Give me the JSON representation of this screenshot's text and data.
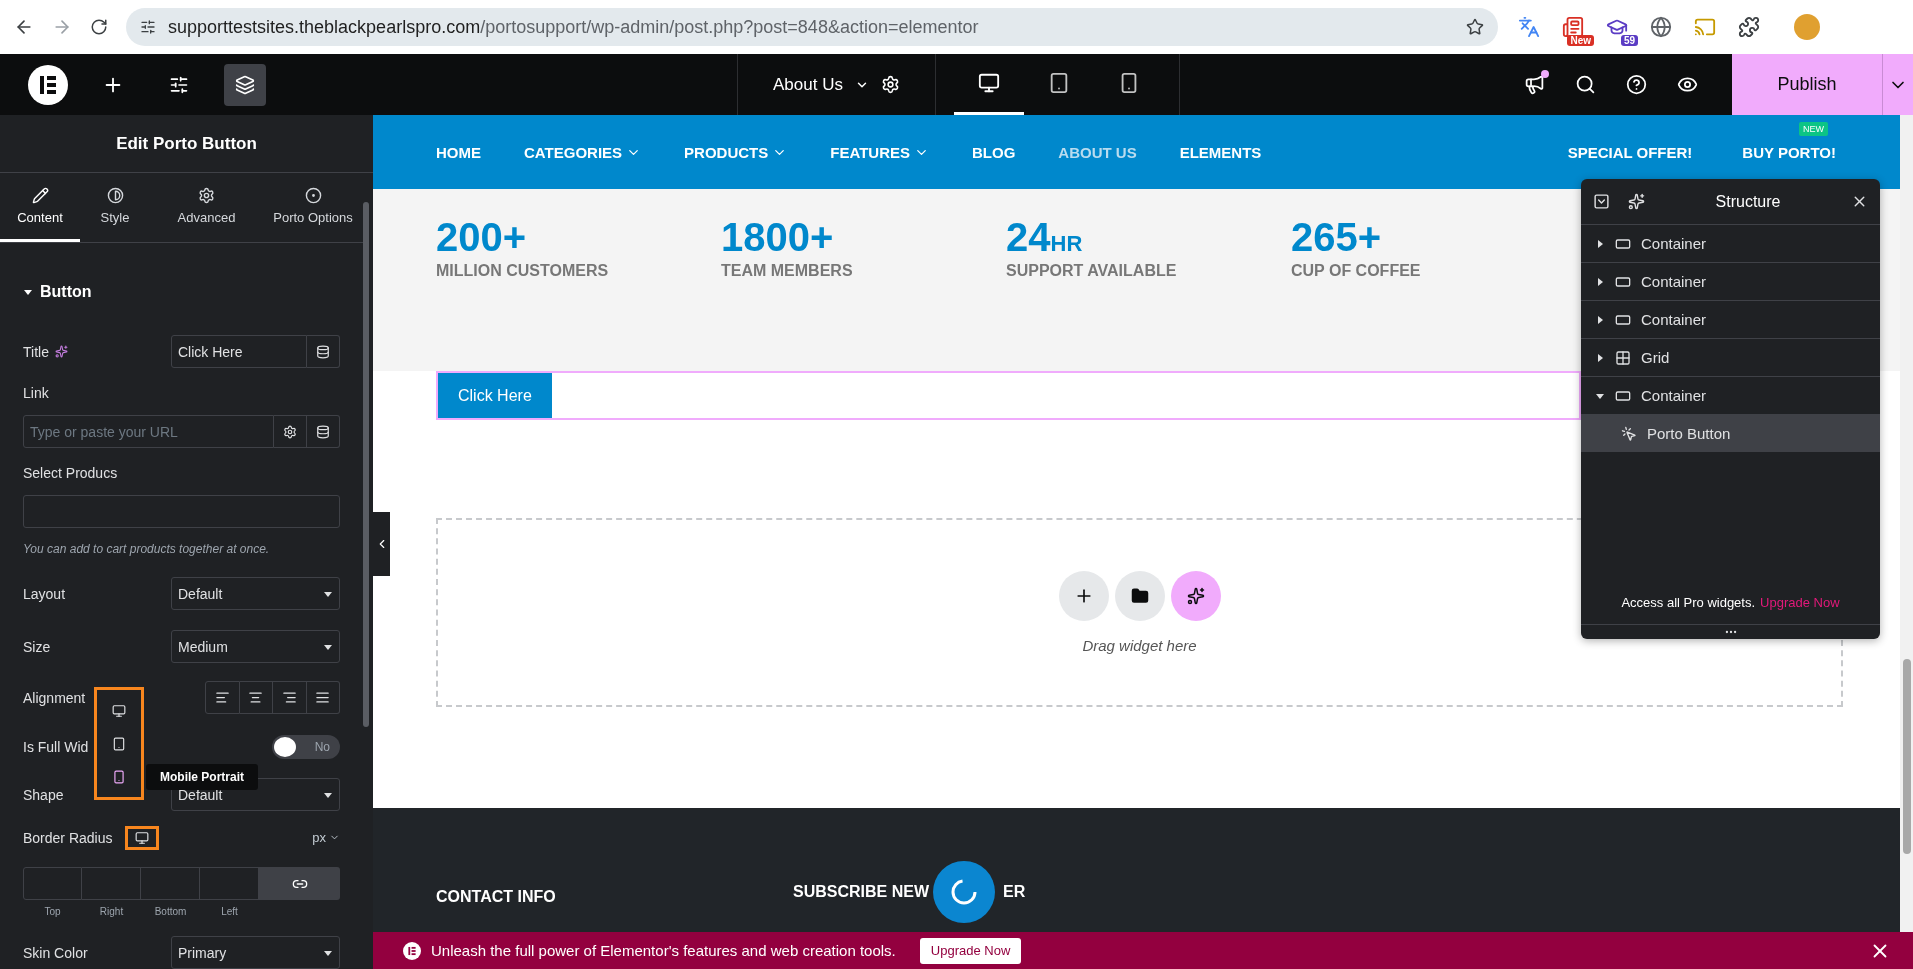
{
  "browser": {
    "url_host": "supporttestsites.theblackpearlspro.com",
    "url_path": "/portosupport/wp-admin/post.php?post=848&action=elementor",
    "extensions": [
      {
        "kind": "translate"
      },
      {
        "kind": "new",
        "badge": "New"
      },
      {
        "kind": "cap",
        "badge": "59"
      },
      {
        "kind": "globe"
      },
      {
        "kind": "cast"
      },
      {
        "kind": "puzzle"
      }
    ]
  },
  "editor_bar": {
    "page_title": "About Us",
    "devices": [
      {
        "kind": "desktop",
        "selected": true
      },
      {
        "kind": "tablet",
        "selected": false
      },
      {
        "kind": "mobile",
        "selected": false
      }
    ],
    "publish": "Publish"
  },
  "panel": {
    "title": "Edit Porto Button",
    "tabs": [
      {
        "label": "Content",
        "kind": "pencil",
        "selected": true
      },
      {
        "label": "Style",
        "kind": "contrast",
        "selected": false
      },
      {
        "label": "Advanced",
        "kind": "gear",
        "selected": false
      },
      {
        "label": "Porto Options",
        "kind": "dot",
        "selected": false
      }
    ],
    "section": {
      "title": "Button",
      "expanded": true
    },
    "controls": [
      {
        "kind": "text",
        "label": "Title",
        "value": "Click Here"
      },
      {
        "kind": "url",
        "label": "Link",
        "placeholder": "Type or paste your URL"
      },
      {
        "kind": "multi",
        "label": "Select Producs"
      },
      {
        "kind": "note",
        "text": "You can add to cart products together at once."
      },
      {
        "kind": "select",
        "label": "Layout",
        "value": "Default"
      },
      {
        "kind": "select",
        "label": "Size",
        "value": "Medium"
      },
      {
        "kind": "align",
        "label": "Alignment"
      },
      {
        "kind": "switch",
        "label": "Is Full Wid",
        "on": false,
        "state_label": "No"
      },
      {
        "kind": "select",
        "label": "Shape",
        "value": "Default"
      },
      {
        "kind": "dimensions",
        "label": "Border Radius",
        "unit": "px",
        "sides": [
          "Top",
          "Right",
          "Bottom",
          "Left"
        ]
      },
      {
        "kind": "select",
        "label": "Skin Color",
        "value": "Primary"
      }
    ],
    "device_menu": {
      "items": [
        {
          "kind": "desktop",
          "selected": false
        },
        {
          "kind": "tablet",
          "selected": false
        },
        {
          "kind": "mobile",
          "selected": true
        }
      ],
      "tooltip": "Mobile Portrait"
    }
  },
  "site": {
    "nav": [
      {
        "label": "HOME",
        "menu": false,
        "selected": false
      },
      {
        "label": "CATEGORIES",
        "menu": true,
        "selected": false
      },
      {
        "label": "PRODUCTS",
        "menu": true,
        "selected": false
      },
      {
        "label": "FEATURES",
        "menu": true,
        "selected": false
      },
      {
        "label": "BLOG",
        "menu": false,
        "selected": false
      },
      {
        "label": "ABOUT US",
        "menu": false,
        "selected": true
      },
      {
        "label": "ELEMENTS",
        "menu": false,
        "selected": false
      }
    ],
    "nav_right": [
      {
        "label": "SPECIAL OFFER!"
      },
      {
        "label": "BUY PORTO!",
        "badge": "NEW"
      }
    ],
    "stats": [
      {
        "value": "200+",
        "label": "MILLION CUSTOMERS"
      },
      {
        "value": "1800+",
        "label": "TEAM MEMBERS"
      },
      {
        "value": "24",
        "unit": "HR",
        "label": "SUPPORT AVAILABLE"
      },
      {
        "value": "265+",
        "label": "CUP OF COFFEE"
      }
    ],
    "button": "Click Here",
    "drop_area": {
      "buttons": [
        {
          "kind": "add"
        },
        {
          "kind": "folder"
        },
        {
          "kind": "ai"
        }
      ],
      "hint": "Drag widget here"
    },
    "footer": {
      "contact": "CONTACT INFO",
      "subscribe_start": "SUBSCRIBE NEW",
      "subscribe_end": "ER"
    }
  },
  "structure": {
    "title": "Structure",
    "items": [
      {
        "label": "Container",
        "kind": "container",
        "expanded": false,
        "selected": false
      },
      {
        "label": "Container",
        "kind": "container",
        "expanded": false,
        "selected": false
      },
      {
        "label": "Container",
        "kind": "container",
        "expanded": false,
        "selected": false
      },
      {
        "label": "Grid",
        "kind": "grid",
        "expanded": false,
        "selected": false
      },
      {
        "label": "Container",
        "kind": "container",
        "expanded": true,
        "selected": false,
        "children": [
          {
            "label": "Porto Button",
            "kind": "widget",
            "selected": true
          }
        ]
      }
    ],
    "promo": "Access all Pro widgets.",
    "promo_link": "Upgrade Now"
  },
  "banner": {
    "text": "Unleash the full power of Elementor's features and web creation tools.",
    "button": "Upgrade Now"
  }
}
